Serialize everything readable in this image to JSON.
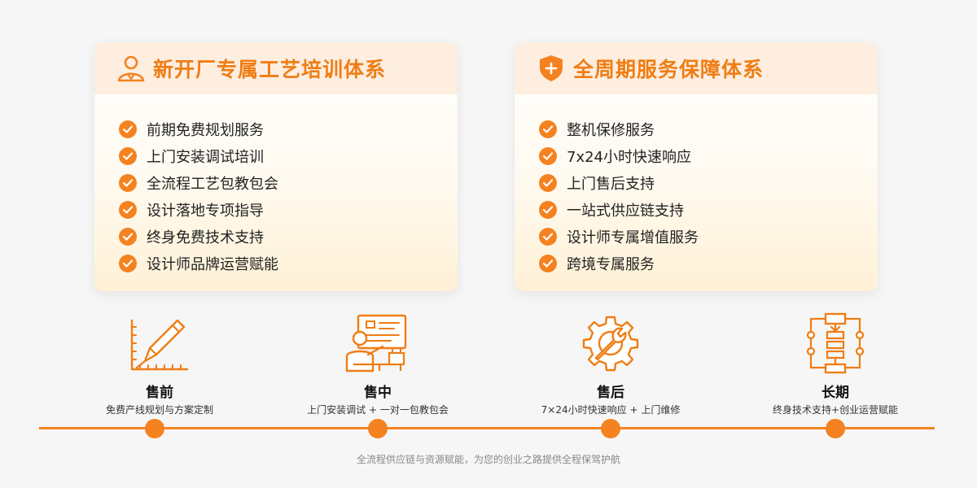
{
  "cards": {
    "training": {
      "title": "新开厂专属工艺培训体系",
      "icon": "person-icon",
      "items": [
        "前期免费规划服务",
        "上门安装调试培训",
        "全流程工艺包教包会",
        "设计落地专项指导",
        "终身免费技术支持",
        "设计师品牌运营赋能"
      ]
    },
    "service": {
      "title": "全周期服务保障体系",
      "icon": "shield-plus-icon",
      "items": [
        "整机保修服务",
        "7x24小时快速响应",
        "上门售后支持",
        "一站式供应链支持",
        "设计师专属增值服务",
        "跨境专属服务"
      ]
    }
  },
  "stages": [
    {
      "title": "售前",
      "desc": "免费产线规划与方案定制",
      "icon": "ruler-pencil-icon"
    },
    {
      "title": "售中",
      "desc": "上门安装调试 + 一对一包教包会",
      "icon": "trainer-board-icon"
    },
    {
      "title": "售后",
      "desc": "7×24小时快速响应 + 上门维修",
      "icon": "gear-wrench-icon"
    },
    {
      "title": "长期",
      "desc": "终身技术支持+创业运营赋能",
      "icon": "process-flow-icon"
    }
  ],
  "footer": "全流程供应链与资源赋能，为您的创业之路提供全程保驾护航",
  "colors": {
    "accent": "#f58220",
    "title": "#f07d14",
    "header_bg": "#fdeee0"
  }
}
